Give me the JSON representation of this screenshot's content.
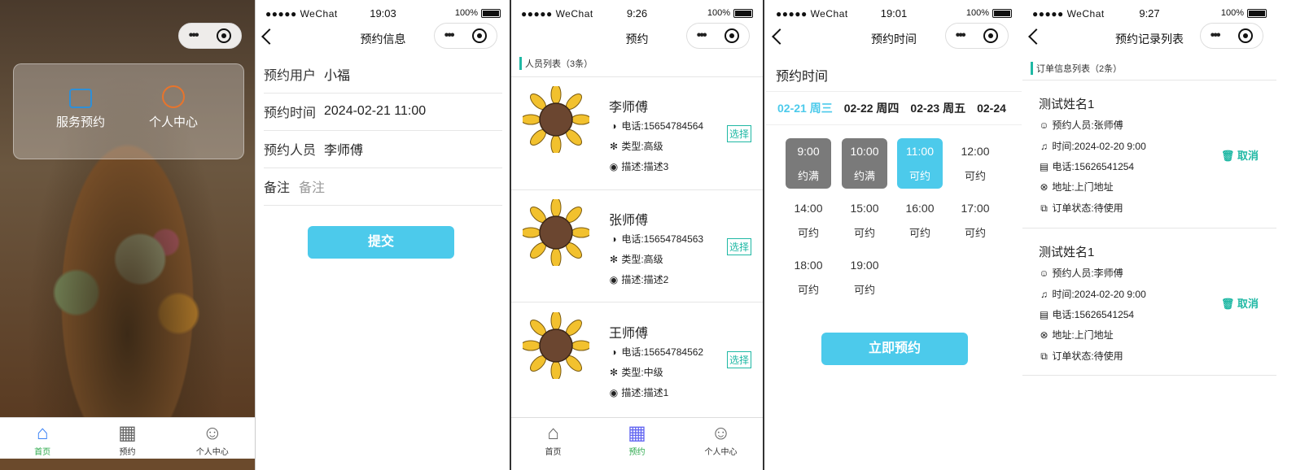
{
  "status": {
    "signal": "●●●●● WeChat",
    "battery": "100%",
    "times": [
      "19:03",
      "9:26",
      "19:01",
      "9:27"
    ]
  },
  "p1": {
    "panel": {
      "service_label": "服务预约",
      "center_label": "个人中心"
    },
    "tabs": [
      "首页",
      "预约",
      "个人中心"
    ]
  },
  "p2": {
    "title": "预约信息",
    "rows": [
      {
        "label": "预约用户",
        "value": "小福"
      },
      {
        "label": "预约时间",
        "value": "2024-02-21 11:00"
      },
      {
        "label": "预约人员",
        "value": "李师傅"
      }
    ],
    "remark_label": "备注",
    "remark_placeholder": "备注",
    "submit": "提交"
  },
  "p3": {
    "title": "预约",
    "section": "人员列表（3条）",
    "people": [
      {
        "name": "李师傅",
        "phone": "电话:15654784564",
        "type": "类型:高级",
        "desc": "描述:描述3",
        "select": "选择"
      },
      {
        "name": "张师傅",
        "phone": "电话:15654784563",
        "type": "类型:高级",
        "desc": "描述:描述2",
        "select": "选择"
      },
      {
        "name": "王师傅",
        "phone": "电话:15654784562",
        "type": "类型:中级",
        "desc": "描述:描述1",
        "select": "选择"
      }
    ],
    "tabs": [
      "首页",
      "预约",
      "个人中心"
    ]
  },
  "p4": {
    "title": "预约时间",
    "heading": "预约时间",
    "dates": [
      "02-21 周三",
      "02-22 周四",
      "02-23 周五",
      "02-24"
    ],
    "slots": [
      {
        "time": "9:00",
        "status": "约满"
      },
      {
        "time": "10:00",
        "status": "约满"
      },
      {
        "time": "11:00",
        "status": "可约"
      },
      {
        "time": "12:00",
        "status": "可约"
      },
      {
        "time": "14:00",
        "status": "可约"
      },
      {
        "time": "15:00",
        "status": "可约"
      },
      {
        "time": "16:00",
        "status": "可约"
      },
      {
        "time": "17:00",
        "status": "可约"
      },
      {
        "time": "18:00",
        "status": "可约"
      },
      {
        "time": "19:00",
        "status": "可约"
      }
    ],
    "book": "立即预约"
  },
  "p5": {
    "title": "预约记录列表",
    "section": "订单信息列表（2条）",
    "orders": [
      {
        "name": "测试姓名1",
        "staff": "预约人员:张师傅",
        "time": "时间:2024-02-20 9:00",
        "phone": "电话:15626541254",
        "addr": "地址:上门地址",
        "state": "订单状态:待使用",
        "cancel": "取消"
      },
      {
        "name": "测试姓名1",
        "staff": "预约人员:李师傅",
        "time": "时间:2024-02-20 9:00",
        "phone": "电话:15626541254",
        "addr": "地址:上门地址",
        "state": "订单状态:待使用",
        "cancel": "取消"
      }
    ]
  },
  "colors": {
    "accent": "#4ccaeb",
    "teal": "#1fb8a4",
    "full_slot": "#7a7a7a"
  }
}
